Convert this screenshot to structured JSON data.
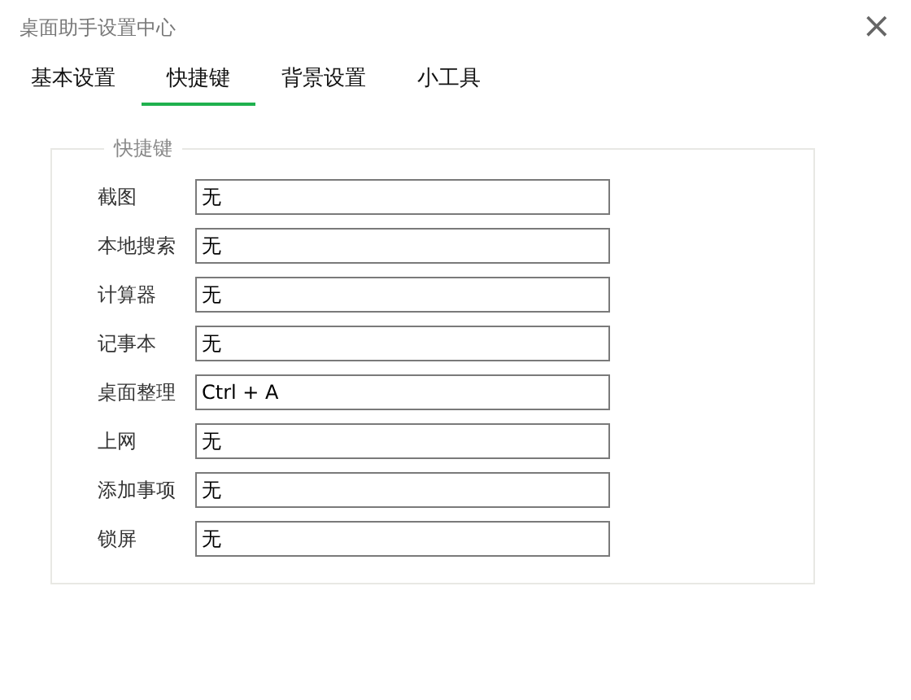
{
  "window": {
    "title": "桌面助手设置中心",
    "close": "×"
  },
  "tabs": [
    {
      "label": "基本设置",
      "selected": false
    },
    {
      "label": "快捷键",
      "selected": true
    },
    {
      "label": "背景设置",
      "selected": false
    },
    {
      "label": "小工具",
      "selected": false
    }
  ],
  "group": {
    "legend": "快捷键",
    "rows": [
      {
        "label": "截图",
        "value": "无"
      },
      {
        "label": "本地搜索",
        "value": "无"
      },
      {
        "label": "计算器",
        "value": "无"
      },
      {
        "label": "记事本",
        "value": "无"
      },
      {
        "label": "桌面整理",
        "value": "Ctrl + A"
      },
      {
        "label": "上网",
        "value": "无"
      },
      {
        "label": "添加事项",
        "value": "无"
      },
      {
        "label": "锁屏",
        "value": "无"
      }
    ]
  }
}
